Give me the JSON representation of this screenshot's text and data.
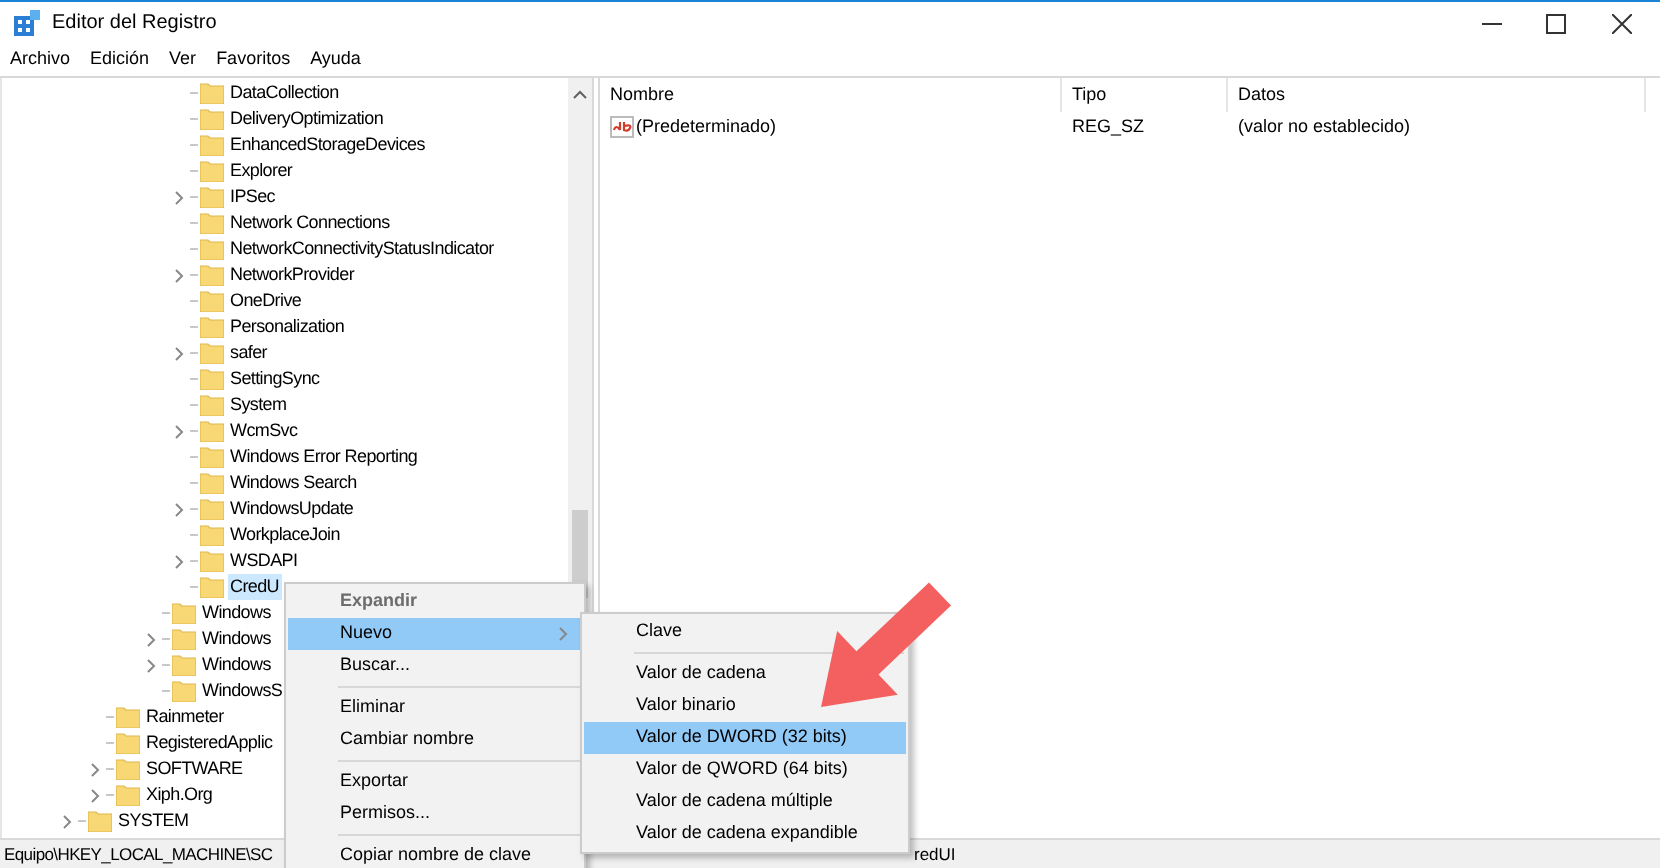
{
  "window": {
    "title": "Editor del Registro"
  },
  "menu_bar": [
    "Archivo",
    "Edición",
    "Ver",
    "Favoritos",
    "Ayuda"
  ],
  "tree": [
    {
      "children": [
        {
          "children": [
            {
              "children": [
                {
                  "children": [
                    {
                      "name": "DataCollection",
                      "expandable": false,
                      "selected": false
                    },
                    {
                      "name": "DeliveryOptimization",
                      "expandable": false,
                      "selected": false
                    },
                    {
                      "name": "EnhancedStorageDevices",
                      "expandable": false,
                      "selected": false
                    },
                    {
                      "name": "Explorer",
                      "expandable": false,
                      "selected": false
                    },
                    {
                      "name": "IPSec",
                      "expandable": true,
                      "selected": false
                    },
                    {
                      "name": "Network Connections",
                      "expandable": false,
                      "selected": false
                    },
                    {
                      "name": "NetworkConnectivityStatusIndicator",
                      "expandable": false,
                      "selected": false
                    },
                    {
                      "name": "NetworkProvider",
                      "expandable": true,
                      "selected": false
                    },
                    {
                      "name": "OneDrive",
                      "expandable": false,
                      "selected": false
                    },
                    {
                      "name": "Personalization",
                      "expandable": false,
                      "selected": false
                    },
                    {
                      "name": "safer",
                      "expandable": true,
                      "selected": false
                    },
                    {
                      "name": "SettingSync",
                      "expandable": false,
                      "selected": false
                    },
                    {
                      "name": "System",
                      "expandable": false,
                      "selected": false
                    },
                    {
                      "name": "WcmSvc",
                      "expandable": true,
                      "selected": false
                    },
                    {
                      "name": "Windows Error Reporting",
                      "expandable": false,
                      "selected": false
                    },
                    {
                      "name": "Windows Search",
                      "expandable": false,
                      "selected": false
                    },
                    {
                      "name": "WindowsUpdate",
                      "expandable": true,
                      "selected": false
                    },
                    {
                      "name": "WorkplaceJoin",
                      "expandable": false,
                      "selected": false
                    },
                    {
                      "name": "WSDAPI",
                      "expandable": true,
                      "selected": false
                    },
                    {
                      "name": "CredU",
                      "expandable": false,
                      "selected": true
                    }
                  ]
                },
                {
                  "name": "Windows",
                  "expandable": false,
                  "selected": false
                },
                {
                  "name": "Windows",
                  "expandable": true,
                  "selected": false
                },
                {
                  "name": "Windows",
                  "expandable": true,
                  "selected": false
                },
                {
                  "name": "WindowsS",
                  "expandable": false,
                  "selected": false
                }
              ]
            }
          ]
        },
        {
          "name": "Rainmeter",
          "expandable": false,
          "selected": false
        },
        {
          "name": "RegisteredApplic",
          "expandable": false,
          "selected": false
        },
        {
          "name": "SOFTWARE",
          "expandable": true,
          "selected": false
        },
        {
          "name": "Xiph.Org",
          "expandable": true,
          "selected": false
        }
      ]
    },
    {
      "name": "SYSTEM",
      "expandable": true,
      "selected": false
    }
  ],
  "values_table": {
    "columns": [
      "Nombre",
      "Tipo",
      "Datos"
    ],
    "rows": [
      {
        "name": "(Predeterminado)",
        "type": "REG_SZ",
        "data": "(valor no establecido)"
      }
    ]
  },
  "status_bar": {
    "path_start": "Equipo\\HKEY_LOCAL_MACHINE\\SC",
    "path_end": "redUI"
  },
  "context_menu": {
    "items": [
      {
        "kind": "item",
        "label": "Expandir",
        "default": true,
        "disabled": true,
        "selected": false,
        "submenu": false
      },
      {
        "kind": "item",
        "label": "Nuevo",
        "default": false,
        "disabled": false,
        "selected": true,
        "submenu": true
      },
      {
        "kind": "item",
        "label": "Buscar...",
        "default": false,
        "disabled": false,
        "selected": false,
        "submenu": false
      },
      {
        "kind": "separator"
      },
      {
        "kind": "item",
        "label": "Eliminar",
        "default": false,
        "disabled": false,
        "selected": false,
        "submenu": false
      },
      {
        "kind": "item",
        "label": "Cambiar nombre",
        "default": false,
        "disabled": false,
        "selected": false,
        "submenu": false
      },
      {
        "kind": "separator"
      },
      {
        "kind": "item",
        "label": "Exportar",
        "default": false,
        "disabled": false,
        "selected": false,
        "submenu": false
      },
      {
        "kind": "item",
        "label": "Permisos...",
        "default": false,
        "disabled": false,
        "selected": false,
        "submenu": false
      },
      {
        "kind": "separator"
      },
      {
        "kind": "item",
        "label": "Copiar nombre de clave",
        "default": false,
        "disabled": false,
        "selected": false,
        "submenu": false
      }
    ]
  },
  "submenu": {
    "items": [
      {
        "kind": "item",
        "label": "Clave",
        "default": false,
        "disabled": false,
        "selected": false
      },
      {
        "kind": "separator"
      },
      {
        "kind": "item",
        "label": "Valor de cadena",
        "default": false,
        "disabled": false,
        "selected": false
      },
      {
        "kind": "item",
        "label": "Valor binario",
        "default": false,
        "disabled": false,
        "selected": false
      },
      {
        "kind": "item",
        "label": "Valor de DWORD (32 bits)",
        "default": false,
        "disabled": false,
        "selected": true
      },
      {
        "kind": "item",
        "label": "Valor de QWORD (64 bits)",
        "default": false,
        "disabled": false,
        "selected": false
      },
      {
        "kind": "item",
        "label": "Valor de cadena múltiple",
        "default": false,
        "disabled": false,
        "selected": false
      },
      {
        "kind": "item",
        "label": "Valor de cadena expandible",
        "default": false,
        "disabled": false,
        "selected": false
      }
    ]
  }
}
